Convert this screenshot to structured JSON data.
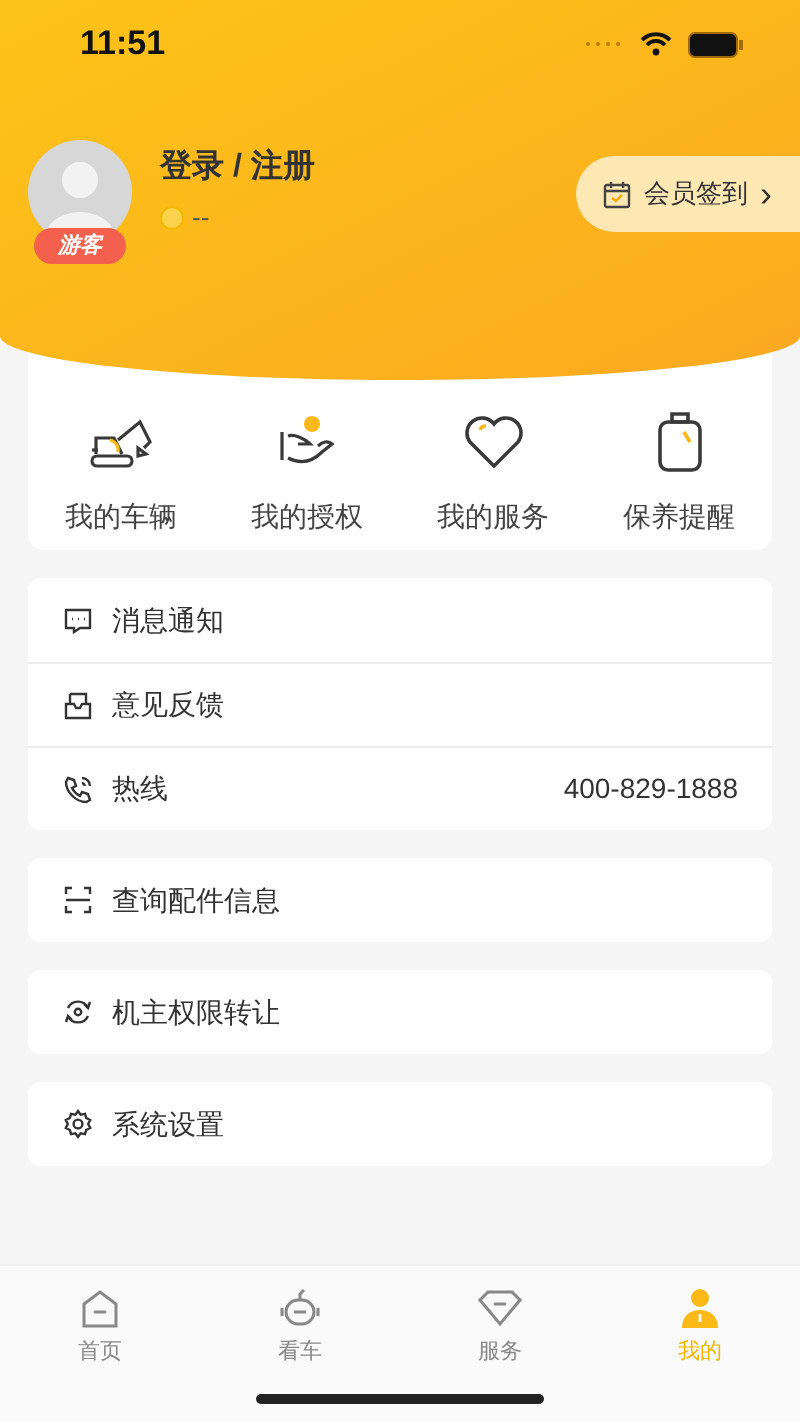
{
  "status_bar": {
    "time": "11:51"
  },
  "profile": {
    "title": "登录 / 注册",
    "badge": "游客",
    "points": "--",
    "checkin": "会员签到",
    "checkin_arrow": "›"
  },
  "shortcuts": [
    {
      "kind": "vehicle",
      "label": "我的车辆"
    },
    {
      "kind": "authorize",
      "label": "我的授权"
    },
    {
      "kind": "service",
      "label": "我的服务"
    },
    {
      "kind": "maintenance",
      "label": "保养提醒"
    }
  ],
  "menu_groups": [
    [
      {
        "kind": "message",
        "label": "消息通知"
      },
      {
        "kind": "feedback",
        "label": "意见反馈"
      },
      {
        "kind": "hotline",
        "label": "热线",
        "value": "400-829-1888"
      }
    ],
    [
      {
        "kind": "scan",
        "label": "查询配件信息"
      }
    ],
    [
      {
        "kind": "transfer",
        "label": "机主权限转让"
      }
    ],
    [
      {
        "kind": "settings",
        "label": "系统设置"
      }
    ]
  ],
  "tab_bar": [
    {
      "kind": "home",
      "label": "首页",
      "selected": false
    },
    {
      "kind": "robot",
      "label": "看车",
      "selected": false
    },
    {
      "kind": "diamond",
      "label": "服务",
      "selected": false
    },
    {
      "kind": "person",
      "label": "我的",
      "selected": true
    }
  ]
}
